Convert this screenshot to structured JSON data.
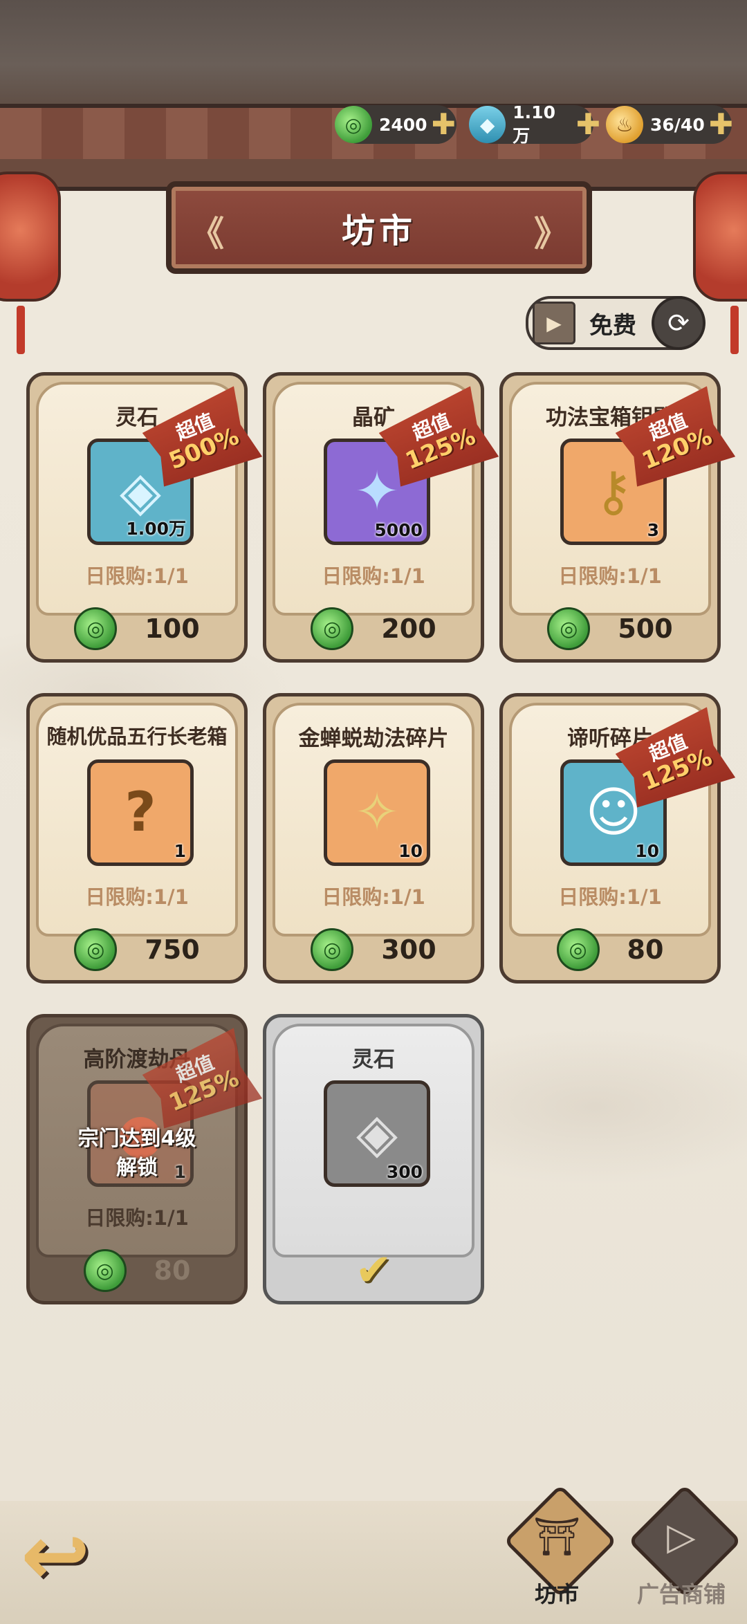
{
  "header": {
    "currencies": [
      {
        "icon": "jade-coin-icon",
        "value": "2400"
      },
      {
        "icon": "crystal-icon",
        "value": "1.10万"
      },
      {
        "icon": "gourd-energy-icon",
        "value": "36/40"
      }
    ],
    "title": "坊市"
  },
  "refresh": {
    "free_label": "免费"
  },
  "cards": [
    {
      "name": "灵石",
      "qty": "1.00万",
      "badge_top": "超值",
      "badge_pct": "500%",
      "limit": "日限购:1/1",
      "price": "100",
      "icon": "spirit-stone-icon",
      "art": "◈",
      "bg": "#5fb3c9"
    },
    {
      "name": "晶矿",
      "qty": "5000",
      "badge_top": "超值",
      "badge_pct": "125%",
      "limit": "日限购:1/1",
      "price": "200",
      "icon": "crystal-ore-icon",
      "art": "✦",
      "bg": "#8d6ad4"
    },
    {
      "name": "功法宝箱钥匙",
      "qty": "3",
      "badge_top": "超值",
      "badge_pct": "120%",
      "limit": "日限购:1/1",
      "price": "500",
      "icon": "chest-key-icon",
      "art": "⚷",
      "bg": "#f0a86a"
    },
    {
      "name": "随机优品五行长老箱",
      "qty": "1",
      "limit": "日限购:1/1",
      "price": "750",
      "icon": "treasure-box-icon",
      "art": "?",
      "bg": "#f0a86a"
    },
    {
      "name": "金蝉蜕劫法碎片",
      "qty": "10",
      "limit": "日限购:1/1",
      "price": "300",
      "icon": "golden-shard-icon",
      "art": "✧",
      "bg": "#f0a86a"
    },
    {
      "name": "谛听碎片",
      "qty": "10",
      "badge_top": "超值",
      "badge_pct": "125%",
      "limit": "日限购:1/1",
      "price": "80",
      "icon": "character-portrait-icon",
      "art": "☺",
      "bg": "#5fb3c9"
    },
    {
      "name": "高阶渡劫丹",
      "qty": "1",
      "badge_top": "超值",
      "badge_pct": "125%",
      "limit": "日限购:1/1",
      "price": "80",
      "icon": "pill-icon",
      "art": "●",
      "bg": "#c97a5a",
      "lock_line1": "宗门达到4级",
      "lock_line2": "解锁"
    },
    {
      "name": "灵石",
      "qty": "300",
      "icon": "spirit-stone-icon",
      "art": "◈",
      "bg": "#8a8a8a"
    }
  ],
  "nav": {
    "tab_market": "坊市",
    "tab_ad_shop": "广告商铺"
  }
}
